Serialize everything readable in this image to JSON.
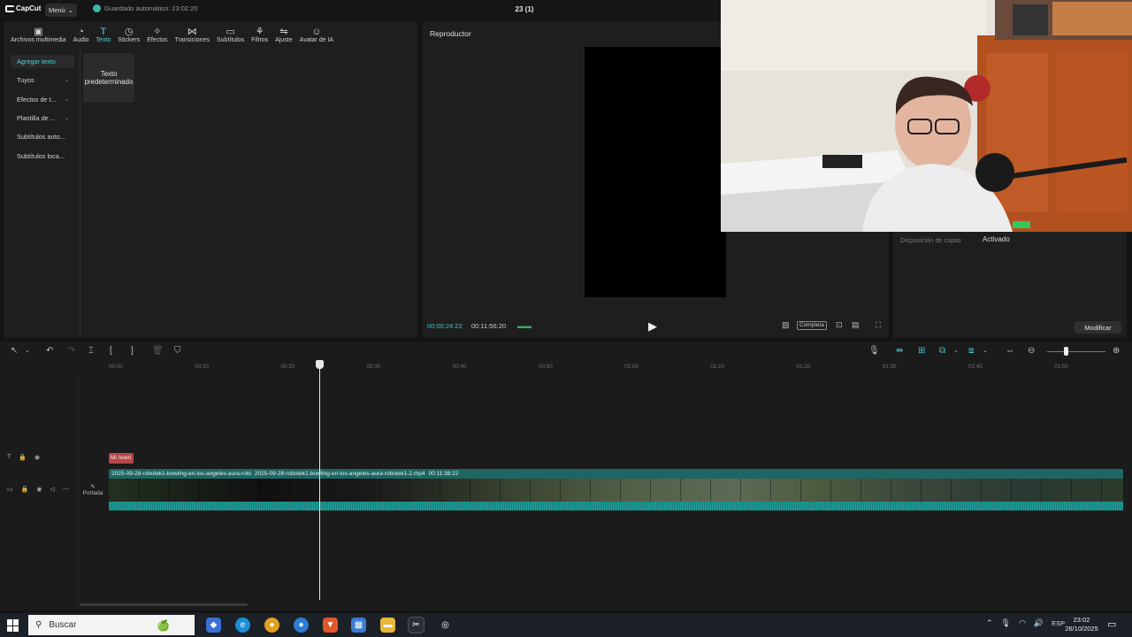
{
  "app": {
    "logo": "CapCut",
    "menu_label": "Menú",
    "autosave": "Guardado automático: 23:02:20",
    "project_title": "23 (1)"
  },
  "toolbar": [
    {
      "icon": "media-icon",
      "glyph": "▣",
      "label": "Archivos multimedia"
    },
    {
      "icon": "audio-icon",
      "glyph": "◔",
      "label": "Audio"
    },
    {
      "icon": "text-icon",
      "glyph": "T",
      "label": "Texto"
    },
    {
      "icon": "sticker-icon",
      "glyph": "◷",
      "label": "Stickers"
    },
    {
      "icon": "effects-icon",
      "glyph": "✧",
      "label": "Efectos"
    },
    {
      "icon": "transition-icon",
      "glyph": "⋈",
      "label": "Transiciones"
    },
    {
      "icon": "subtitles-icon",
      "glyph": "▭",
      "label": "Subtítulos"
    },
    {
      "icon": "filter-icon",
      "glyph": "⚘",
      "label": "Filtros"
    },
    {
      "icon": "adjust-icon",
      "glyph": "⇋",
      "label": "Ajuste"
    },
    {
      "icon": "ai-avatar-icon",
      "glyph": "☺",
      "label": "Avatar de IA"
    }
  ],
  "sidebar": [
    {
      "label": "Agregar texto"
    },
    {
      "label": "Tuyos"
    },
    {
      "label": "Efectos de t..."
    },
    {
      "label": "Plantilla de ..."
    },
    {
      "label": "Subtítulos auto..."
    },
    {
      "label": "Subtítulos loca..."
    }
  ],
  "text_card": "Texto predeterminado",
  "player": {
    "title": "Reproductor",
    "current_time": "00:00:24:22",
    "total_time": "00:11:56:20",
    "ratio_label": "Completa"
  },
  "right_panel": {
    "layer_label": "Disposición de capas",
    "layer_value": "Activado",
    "modify_label": "Modificar"
  },
  "ruler_ticks": [
    "00:00",
    "00:10",
    "00:20",
    "00:30",
    "00:40",
    "00:50",
    "01:00",
    "01:10",
    "01:20",
    "01:30",
    "01:40",
    "01:50"
  ],
  "text_clip": "Mi reem",
  "cover_label": "Portada",
  "video_clip": {
    "name_1": "2025-09-28-robotek1-bowling-en-los-angeles-aura-robi",
    "name_2": "2025-09-28-robotek1-bowling-en-los-angeles-aura-robotek1-2.mp4",
    "duration": "00:11:38:22"
  },
  "taskbar": {
    "search_placeholder": "Buscar",
    "lang": "ESP",
    "time": "23:02",
    "date": "26/10/2025"
  },
  "colors": {
    "accent": "#4fd1d9",
    "clip": "#1b5f5e",
    "text_clip": "#b5484a"
  }
}
